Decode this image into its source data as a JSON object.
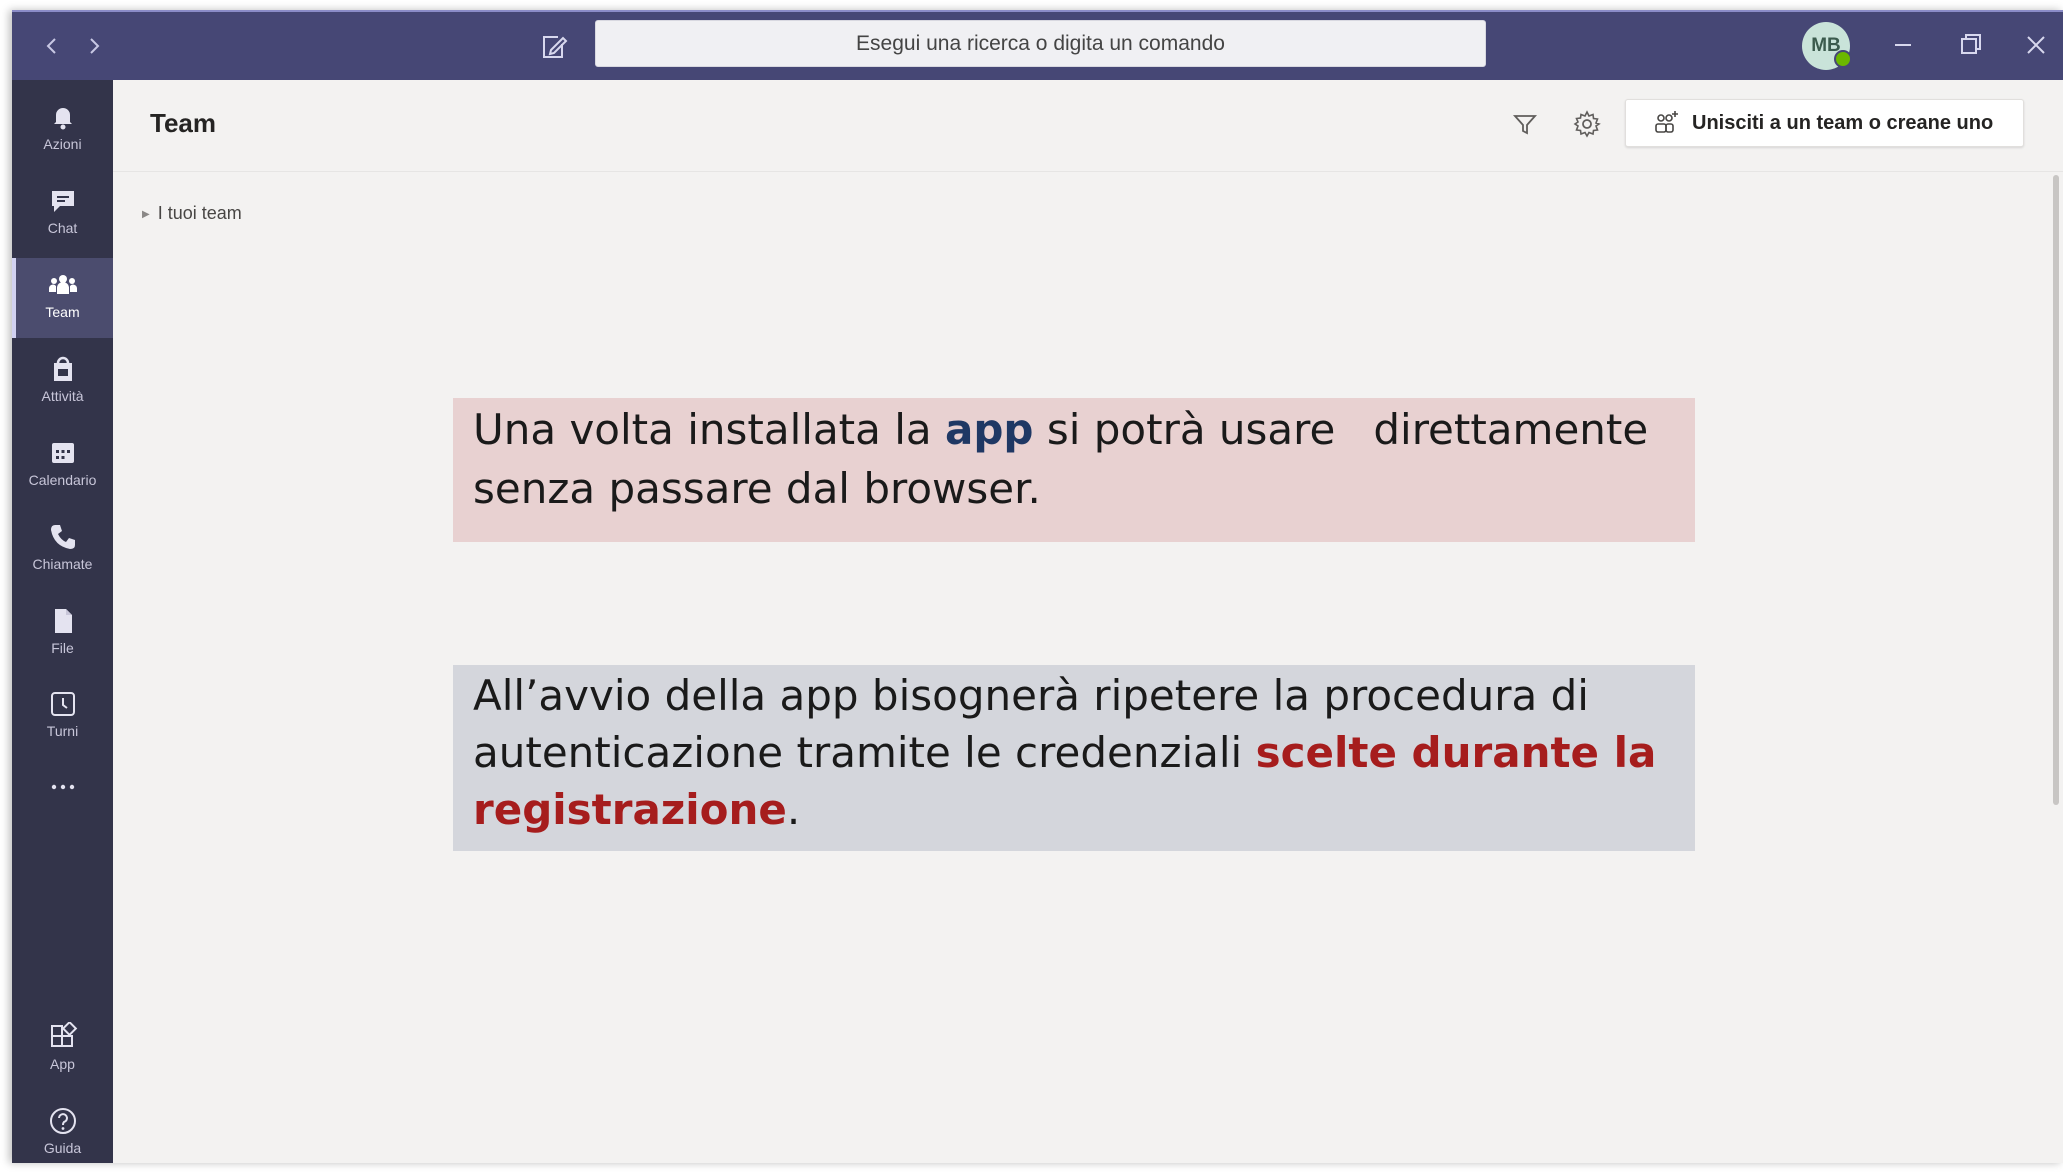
{
  "titlebar": {
    "back_icon": "chevron-left-icon",
    "forward_icon": "chevron-right-icon",
    "compose_icon": "compose-icon",
    "search_placeholder": "Esegui una ricerca o digita un comando",
    "avatar_initials": "MB",
    "presence_color": "#6bb700"
  },
  "rail": {
    "items": [
      {
        "label": "Azioni",
        "icon": "bell-icon"
      },
      {
        "label": "Chat",
        "icon": "chat-icon"
      },
      {
        "label": "Team",
        "icon": "teams-icon",
        "active": true
      },
      {
        "label": "Attività",
        "icon": "assignments-icon"
      },
      {
        "label": "Calendario",
        "icon": "calendar-icon"
      },
      {
        "label": "Chiamate",
        "icon": "phone-icon"
      },
      {
        "label": "File",
        "icon": "file-icon"
      },
      {
        "label": "Turni",
        "icon": "clock-icon"
      },
      {
        "label": "App",
        "icon": "apps-icon"
      },
      {
        "label": "Guida",
        "icon": "help-icon"
      }
    ],
    "more_icon": "ellipsis-icon"
  },
  "header": {
    "title": "Team",
    "filter_icon": "filter-icon",
    "settings_icon": "gear-icon",
    "join_button_label": "Unisciti a un team o creane uno"
  },
  "teams_list": {
    "section_label": "I tuoi team"
  },
  "callouts": {
    "first": {
      "part1": "Una volta installata la",
      "highlight": "app",
      "part2": "si potrà usare",
      "part3": "direttamente senza passare dal browser."
    },
    "second": {
      "part1": "All’avvio della app bisognerà ripetere la procedura di autenticazione tramite le credenziali",
      "highlight": "scelte durante la registrazione",
      "part2": "."
    }
  },
  "colors": {
    "titlebar": "#464775",
    "rail": "#33344a",
    "accent_blue": "#1f3864",
    "accent_red": "#a61d1d"
  }
}
